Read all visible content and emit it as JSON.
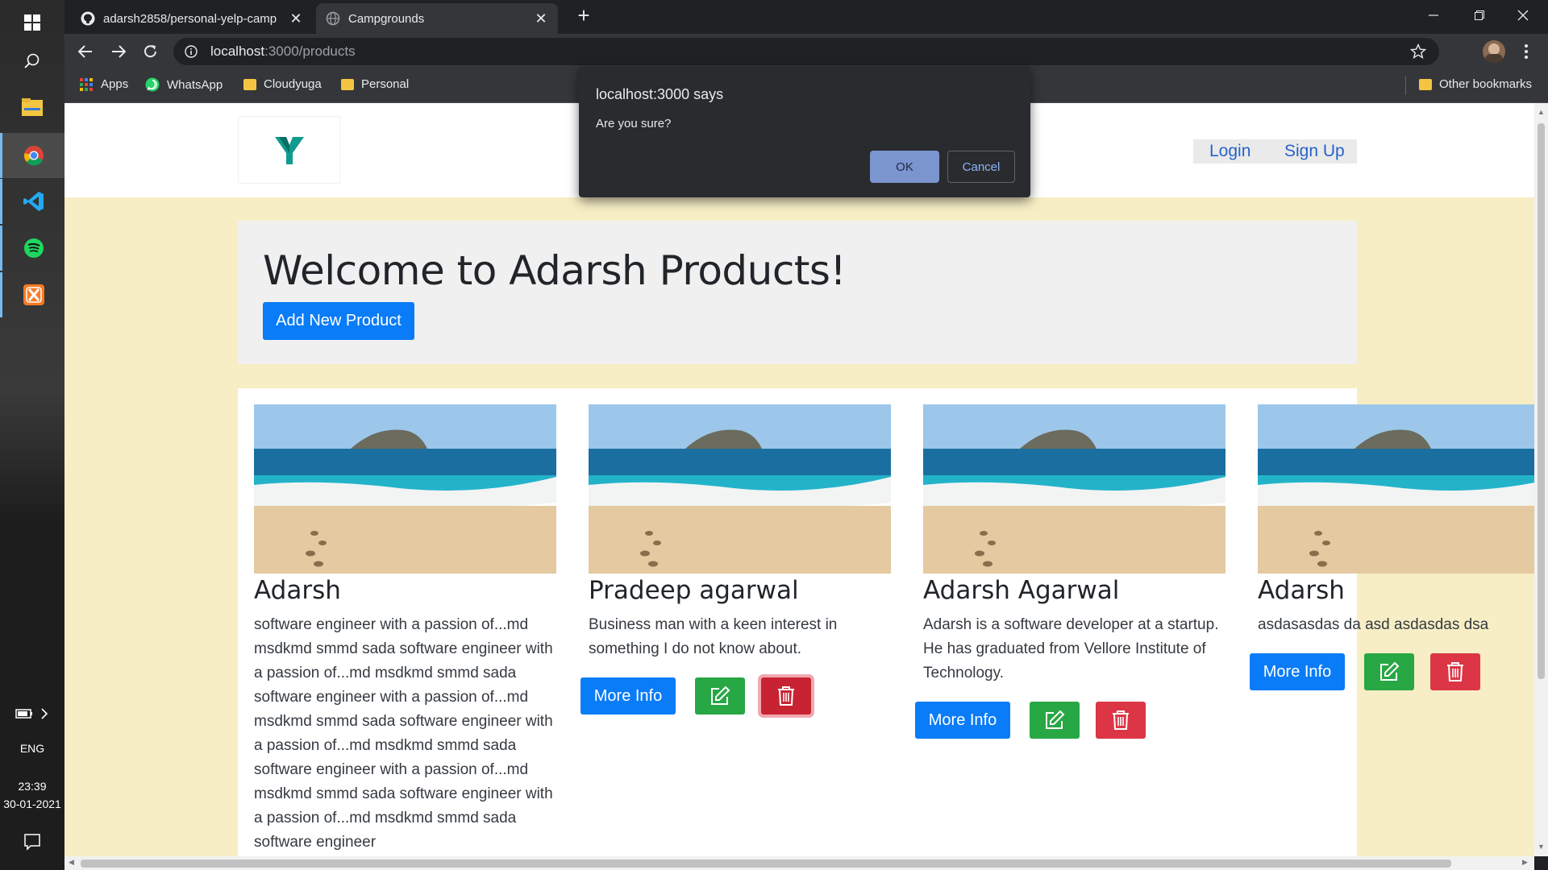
{
  "taskbar": {
    "icons": [
      "windows-start-icon",
      "search-icon",
      "file-explorer-icon",
      "chrome-icon",
      "vscode-icon",
      "spotify-icon",
      "xampp-icon"
    ],
    "battery_icon": "battery-icon",
    "chevron": "chevron-right-icon",
    "language": "ENG",
    "time": "23:39",
    "date": "30-01-2021",
    "notification_icon": "notification-icon"
  },
  "browser": {
    "tabs": [
      {
        "title": "adarsh2858/personal-yelp-camp",
        "icon": "github-icon",
        "active": false
      },
      {
        "title": "Campgrounds",
        "icon": "globe-icon",
        "active": true
      }
    ],
    "new_tab": "+",
    "url_host": "localhost",
    "url_rest": ":3000/products",
    "bookmarks": [
      {
        "label": "Apps",
        "icon": "apps-grid-icon"
      },
      {
        "label": "WhatsApp",
        "icon": "whatsapp-icon"
      },
      {
        "label": "Cloudyuga",
        "icon": "folder-icon"
      },
      {
        "label": "Personal",
        "icon": "folder-icon"
      }
    ],
    "other_bookmarks": "Other bookmarks"
  },
  "page": {
    "nav": {
      "login": "Login",
      "signup": "Sign Up"
    },
    "heading": "Welcome to Adarsh Products!",
    "add_button": "Add New Product",
    "products": [
      {
        "name": "Adarsh",
        "description": "software engineer with a passion of...md msdkmd smmd sada software engineer with a passion of...md msdkmd smmd sada software engineer with a passion of...md msdkmd smmd sada software engineer with a passion of...md msdkmd smmd sada software engineer with a passion of...md msdkmd smmd sada software engineer with a passion of...md msdkmd smmd sada software engineer",
        "more_info": "More Info"
      },
      {
        "name": "Pradeep agarwal",
        "description": "Business man with a keen interest in something I do not know about.",
        "more_info": "More Info"
      },
      {
        "name": "Adarsh Agarwal",
        "description": "Adarsh is a software developer at a startup. He has graduated from Vellore Institute of Technology.",
        "more_info": "More Info"
      },
      {
        "name": "Adarsh",
        "description": "asdasasdas da asd asdasdas dsa",
        "more_info": "More Info"
      }
    ]
  },
  "dialog": {
    "title": "localhost:3000 says",
    "message": "Are you sure?",
    "ok": "OK",
    "cancel": "Cancel"
  },
  "colors": {
    "primary": "#0a7cf7",
    "success": "#28a745",
    "danger": "#dc3545",
    "page_background": "#f7eec5"
  }
}
